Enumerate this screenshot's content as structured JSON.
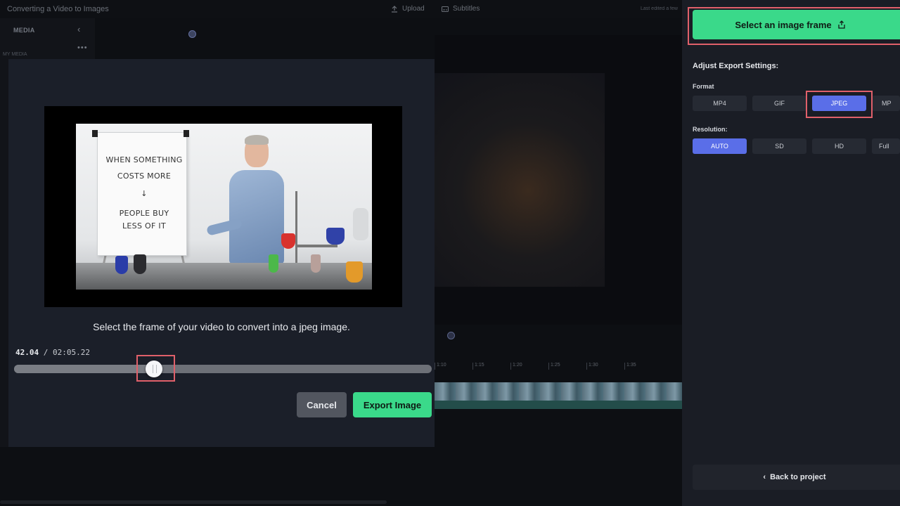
{
  "editor": {
    "project_title": "Converting a Video to Images",
    "upload_label": "Upload",
    "subtitles_label": "Subtitles",
    "last_edited": "Last edited a few",
    "media_title": "MEDIA",
    "my_media": "MY MEDIA",
    "timeline_ticks": [
      "1:10",
      "1:15",
      "1:20",
      "1:25",
      "1:30",
      "1:35"
    ]
  },
  "modal": {
    "flipchart_lines": [
      "WHEN SOMETHING",
      "COSTS MORE",
      "↓",
      "PEOPLE BUY",
      "LESS OF IT"
    ],
    "caption": "Select the frame of your video to convert into a jpeg image.",
    "current_time": "42.04",
    "separator": " / ",
    "total_time": "02:05.22",
    "scrubber_progress": 0.335,
    "cancel_label": "Cancel",
    "export_label": "Export Image"
  },
  "export_panel": {
    "select_frame_label": "Select an image frame",
    "adjust_title": "Adjust Export Settings:",
    "format_label": "Format",
    "formats": [
      "MP4",
      "GIF",
      "JPEG",
      "MP"
    ],
    "selected_format": "JPEG",
    "resolution_label": "Resolution:",
    "resolutions": [
      "AUTO",
      "SD",
      "HD",
      "Full"
    ],
    "selected_resolution": "AUTO",
    "back_label": "Back to project"
  },
  "colors": {
    "accent_green": "#3ad98a",
    "accent_blue": "#5a6ee8",
    "highlight_red": "#e0606a"
  },
  "icons": {
    "upload": "upload-icon",
    "subtitles": "subtitles-icon",
    "collapse": "chevron-left-icon",
    "more": "more-icon",
    "share": "share-icon",
    "back": "chevron-left-icon"
  }
}
